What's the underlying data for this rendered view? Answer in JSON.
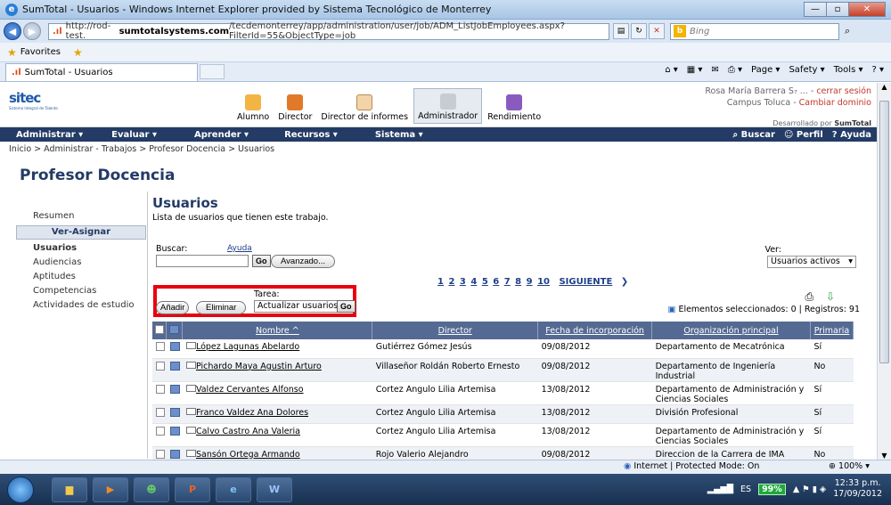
{
  "window": {
    "title": "SumTotal - Usuarios - Windows Internet Explorer provided by Sistema Tecnológico de Monterrey",
    "url_prefix": "http://rod-test.",
    "url_domain": "sumtotalsystems.com",
    "url_rest": "/tecdemonterrey/app/administration/user/job/ADM_ListJobEmployees.aspx?FilterId=55&ObjectType=job",
    "search_placeholder": "Bing"
  },
  "favorites": {
    "label": "Favorites"
  },
  "tab": {
    "label": "SumTotal - Usuarios"
  },
  "commandbar": {
    "page": "Page ▾",
    "safety": "Safety ▾",
    "tools": "Tools ▾"
  },
  "header": {
    "logo": "sitec",
    "logo_sub": "Sistema Integral de Talento",
    "roles": [
      {
        "label": "Alumno",
        "icon": "student-icon"
      },
      {
        "label": "Director",
        "icon": "director-icon"
      },
      {
        "label": "Director de informes",
        "icon": "reports-icon"
      },
      {
        "label": "Administrador",
        "icon": "admin-icon"
      },
      {
        "label": "Rendimiento",
        "icon": "performance-icon"
      }
    ],
    "user_name": "Rosa María Barrera S₇ ... -",
    "logout": "cerrar sesión",
    "campus": "Campus Toluca -",
    "change_domain": "Cambiar dominio",
    "developed_by": "Desarrollado por",
    "developed_brand": "SumTotal"
  },
  "menu": {
    "items": [
      "Administrar ▾",
      "Evaluar ▾",
      "Aprender ▾",
      "Recursos ▾",
      "Sistema ▾"
    ],
    "buscar": "Buscar",
    "perfil": "Perfil",
    "ayuda": "Ayuda"
  },
  "breadcrumb": "Inicio > Administrar - Trabajos > Profesor Docencia > Usuarios",
  "page_title": "Profesor Docencia",
  "leftnav": {
    "resumen": "Resumen",
    "section": "Ver-Asignar",
    "items": [
      "Usuarios",
      "Audiencias",
      "Aptitudes",
      "Competencias",
      "Actividades de estudio"
    ]
  },
  "main": {
    "heading": "Usuarios",
    "description": "Lista de usuarios que tienen este trabajo.",
    "buscar_label": "Buscar:",
    "ayuda_link": "Ayuda",
    "go": "Go",
    "avanzado": "Avanzado...",
    "ver_label": "Ver:",
    "ver_value": "Usuarios activos",
    "pages": [
      "1",
      "2",
      "3",
      "4",
      "5",
      "6",
      "7",
      "8",
      "9",
      "10"
    ],
    "next": "SIGUIENTE",
    "tarea_label": "Tarea:",
    "anadir": "Añadir",
    "eliminar": "Eliminar",
    "tarea_value": "Actualizar usuarios",
    "selected_info": "Elementos seleccionados: 0 | Registros: 91"
  },
  "table": {
    "headers": [
      "Nombre ^",
      "Director",
      "Fecha de incorporación",
      "Organización principal",
      "Primaria"
    ],
    "rows": [
      [
        "López Lagunas Abelardo",
        "Gutiérrez Gómez Jesús",
        "09/08/2012",
        "Departamento de Mecatrónica",
        "Sí"
      ],
      [
        "Pichardo Maya Agustin Arturo",
        "Villaseñor Roldán Roberto Ernesto",
        "09/08/2012",
        "Departamento de Ingeniería Industrial",
        "No"
      ],
      [
        "Valdez Cervantes Alfonso",
        "Cortez Angulo Lilia Artemisa",
        "13/08/2012",
        "Departamento de Administración y Ciencias Sociales",
        "Sí"
      ],
      [
        "Franco Valdez Ana Dolores",
        "Cortez Angulo Lilia Artemisa",
        "13/08/2012",
        "División Profesional",
        "Sí"
      ],
      [
        "Calvo Castro Ana Valeria",
        "Cortez Angulo Lilia Artemisa",
        "13/08/2012",
        "Departamento de Administración y Ciencias Sociales",
        "Sí"
      ],
      [
        "Sansón Ortega Armando",
        "Rojo Valerio Alejandro",
        "09/08/2012",
        "Direccion de la Carrera de IMA",
        "No"
      ]
    ]
  },
  "status": {
    "protected": "Internet | Protected Mode: On",
    "zoom": "100% ▾"
  },
  "tray": {
    "lang": "ES",
    "battery": "99%",
    "time": "12:33 p.m.",
    "date": "17/09/2012"
  }
}
